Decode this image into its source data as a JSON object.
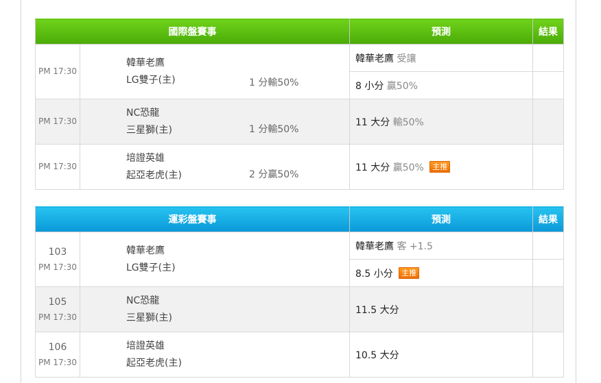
{
  "intl": {
    "header": {
      "title": "國際盤賽事",
      "prediction": "預測",
      "result": "結果"
    },
    "rows": [
      {
        "time": "PM 17:30",
        "away": "韓華老鷹",
        "home": "LG雙子(主)",
        "handicap": "1 分輸50%",
        "pred1_main": "韓華老鷹",
        "pred1_sub": "受讓",
        "pred2_main": "8 小分",
        "pred2_sub": "贏50%"
      },
      {
        "time": "PM 17:30",
        "away": "NC恐龍",
        "home": "三星獅(主)",
        "handicap": "1 分輸50%",
        "pred_main": "11 大分",
        "pred_sub": "輸50%"
      },
      {
        "time": "PM 17:30",
        "away": "培證英雄",
        "home": "起亞老虎(主)",
        "handicap": "2 分贏50%",
        "pred_main": "11 大分",
        "pred_sub": "贏50%",
        "badge": "主推"
      }
    ]
  },
  "lottery": {
    "header": {
      "title": "運彩盤賽事",
      "prediction": "預測",
      "result": "結果"
    },
    "rows": [
      {
        "game_no": "103",
        "time": "PM 17:30",
        "away": "韓華老鷹",
        "home": "LG雙子(主)",
        "pred1_main": "韓華老鷹",
        "pred1_sub": "客 +1.5",
        "pred2_main": "8.5 小分",
        "badge": "主推"
      },
      {
        "game_no": "105",
        "time": "PM 17:30",
        "away": "NC恐龍",
        "home": "三星獅(主)",
        "pred_main": "11.5 大分"
      },
      {
        "game_no": "106",
        "time": "PM 17:30",
        "away": "培證英雄",
        "home": "起亞老虎(主)",
        "pred_main": "10.5 大分"
      }
    ]
  },
  "colors": {
    "green_header": "#5bbf10",
    "blue_header": "#13a9e3",
    "badge": "#f57c0a"
  }
}
